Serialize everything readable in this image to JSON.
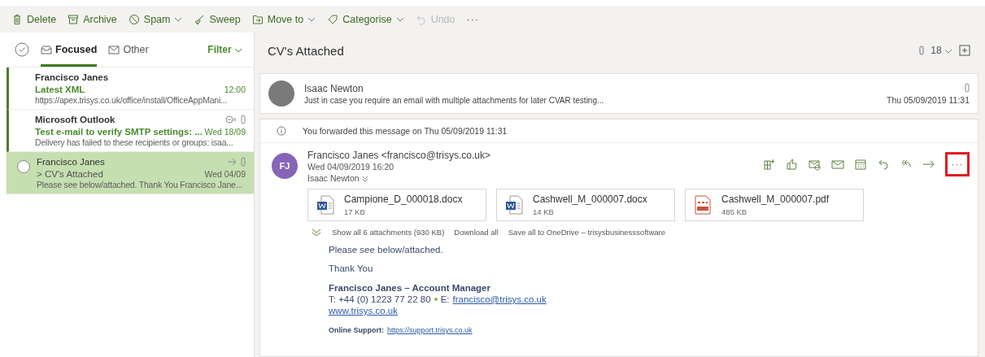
{
  "toolbar": {
    "items": [
      {
        "label": "Delete",
        "dropdown": false,
        "disabled": false
      },
      {
        "label": "Archive",
        "dropdown": false,
        "disabled": false
      },
      {
        "label": "Spam",
        "dropdown": true,
        "disabled": false
      },
      {
        "label": "Sweep",
        "dropdown": false,
        "disabled": false
      },
      {
        "label": "Move to",
        "dropdown": true,
        "disabled": false
      },
      {
        "label": "Categorise",
        "dropdown": true,
        "disabled": false
      },
      {
        "label": "Undo",
        "dropdown": false,
        "disabled": true
      }
    ],
    "more": "···"
  },
  "mail_list": {
    "tabs": [
      {
        "label": "Focused",
        "selected": true
      },
      {
        "label": "Other",
        "selected": false
      }
    ],
    "filter": "Filter",
    "items": [
      {
        "sender": "Francisco Janes",
        "subject": "Latest XML",
        "time": "12:00",
        "preview": "https://apex.trisys.co.uk/office/install/OfficeAppMani...",
        "unread": true,
        "selected": false,
        "forwarded": false,
        "blocked": false,
        "attachment": false
      },
      {
        "sender": "Microsoft Outlook",
        "subject": "Test e-mail to verify SMTP settings: ...",
        "time": "Wed 18/09",
        "preview": "Delivery has failed to these recipients or groups: isaa...",
        "unread": true,
        "selected": false,
        "forwarded": false,
        "blocked": true,
        "attachment": true
      },
      {
        "sender": "Francisco Janes",
        "subject": "> CV's Attached",
        "time": "Wed 04/09",
        "preview": "Please see below/attached. Thank You Francisco Jane...",
        "unread": false,
        "selected": true,
        "forwarded": true,
        "blocked": false,
        "attachment": true
      }
    ]
  },
  "reading_pane": {
    "title": "CV's Attached",
    "attachment_count": "18",
    "collapsed_message": {
      "sender": "Isaac Newton",
      "preview": "Just in case you require an email with multiple attachments for later CVAR testing...",
      "date": "Thu 05/09/2019 11:31"
    },
    "forward_notice": "You forwarded this message on Thu 05/09/2019 11:31",
    "message": {
      "initials": "FJ",
      "from": "Francisco Janes <francisco@trisys.co.uk>",
      "date": "Wed 04/09/2019 16:20",
      "to": "Isaac Newton",
      "more_highlighted": true,
      "more": "···",
      "attachments": [
        {
          "name": "Campione_D_000018.docx",
          "size": "17 KB",
          "kind": "word"
        },
        {
          "name": "Cashwell_M_000007.docx",
          "size": "14 KB",
          "kind": "word"
        },
        {
          "name": "Cashwell_M_000007.pdf",
          "size": "485 KB",
          "kind": "pdf"
        }
      ],
      "attachment_links": [
        "Show all 6 attachments (930 KB)",
        "Download all",
        "Save all to OneDrive – trisysbusinesssoftware"
      ],
      "body": [
        "Please see below/attached.",
        "Thank You"
      ],
      "signature": {
        "name": "Francisco Janes – Account Manager",
        "phone": "T: +44 (0) 1223 77 22 80",
        "email_label": "E:",
        "email": "francisco@trisys.co.uk",
        "website": "www.trisys.co.uk",
        "support": "**Online Support:**",
        "support_link": "https://support.trisys.co.uk"
      }
    }
  }
}
